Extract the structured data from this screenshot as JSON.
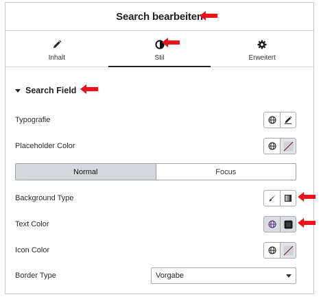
{
  "header": {
    "title": "Search bearbeiten"
  },
  "tabs": [
    {
      "label": "Inhalt",
      "icon": "pencil-icon",
      "active": false
    },
    {
      "label": "Stil",
      "icon": "contrast-icon",
      "active": true
    },
    {
      "label": "Erweitert",
      "icon": "gear-icon",
      "active": false
    }
  ],
  "section": {
    "title": "Search Field",
    "expanded": true
  },
  "controls": {
    "typografie": {
      "label": "Typografie"
    },
    "placeholder_color": {
      "label": "Placeholder Color"
    },
    "state_toggle": {
      "normal": "Normal",
      "focus": "Focus",
      "selected": "Normal"
    },
    "background_type": {
      "label": "Background Type"
    },
    "text_color": {
      "label": "Text Color"
    },
    "icon_color": {
      "label": "Icon Color"
    },
    "border_type": {
      "label": "Border Type",
      "value": "Vorgabe"
    }
  },
  "colors": {
    "annotation_arrow": "#e8151b",
    "toggle_selected": "#d5d8dc"
  }
}
